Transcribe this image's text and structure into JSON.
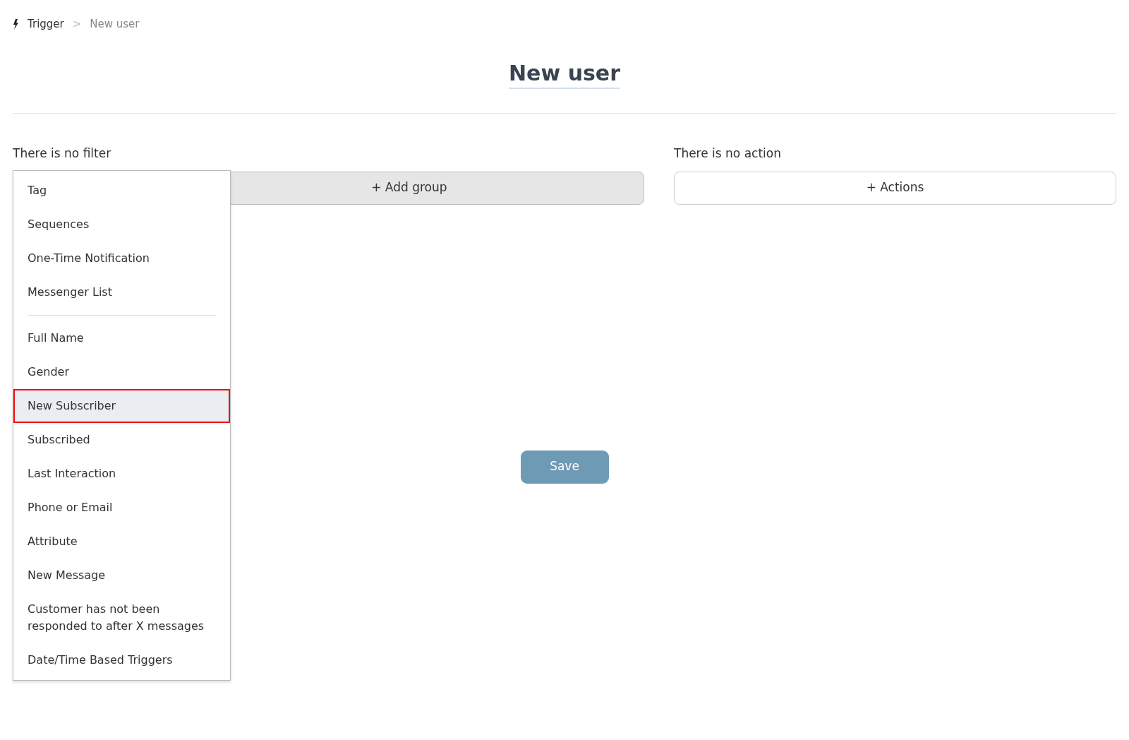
{
  "breadcrumb": {
    "items": [
      "Trigger",
      "New user"
    ],
    "separator": ">"
  },
  "title": "New user",
  "filter": {
    "label": "There is no filter",
    "button": "+ Add group"
  },
  "action": {
    "label": "There is no action",
    "button": "+ Actions"
  },
  "menu": {
    "groups": [
      [
        {
          "label": "Tag",
          "selected": false
        },
        {
          "label": "Sequences",
          "selected": false
        },
        {
          "label": "One-Time Notification",
          "selected": false
        },
        {
          "label": "Messenger List",
          "selected": false
        }
      ],
      [
        {
          "label": "Full Name",
          "selected": false
        },
        {
          "label": "Gender",
          "selected": false
        },
        {
          "label": "New Subscriber",
          "selected": true
        },
        {
          "label": "Subscribed",
          "selected": false
        },
        {
          "label": "Last Interaction",
          "selected": false
        },
        {
          "label": "Phone or Email",
          "selected": false
        },
        {
          "label": "Attribute",
          "selected": false
        },
        {
          "label": "New Message",
          "selected": false
        },
        {
          "label": "Customer has not been responded to after X messages",
          "selected": false
        },
        {
          "label": "Date/Time Based Triggers",
          "selected": false
        }
      ]
    ]
  },
  "save_button": "Save"
}
